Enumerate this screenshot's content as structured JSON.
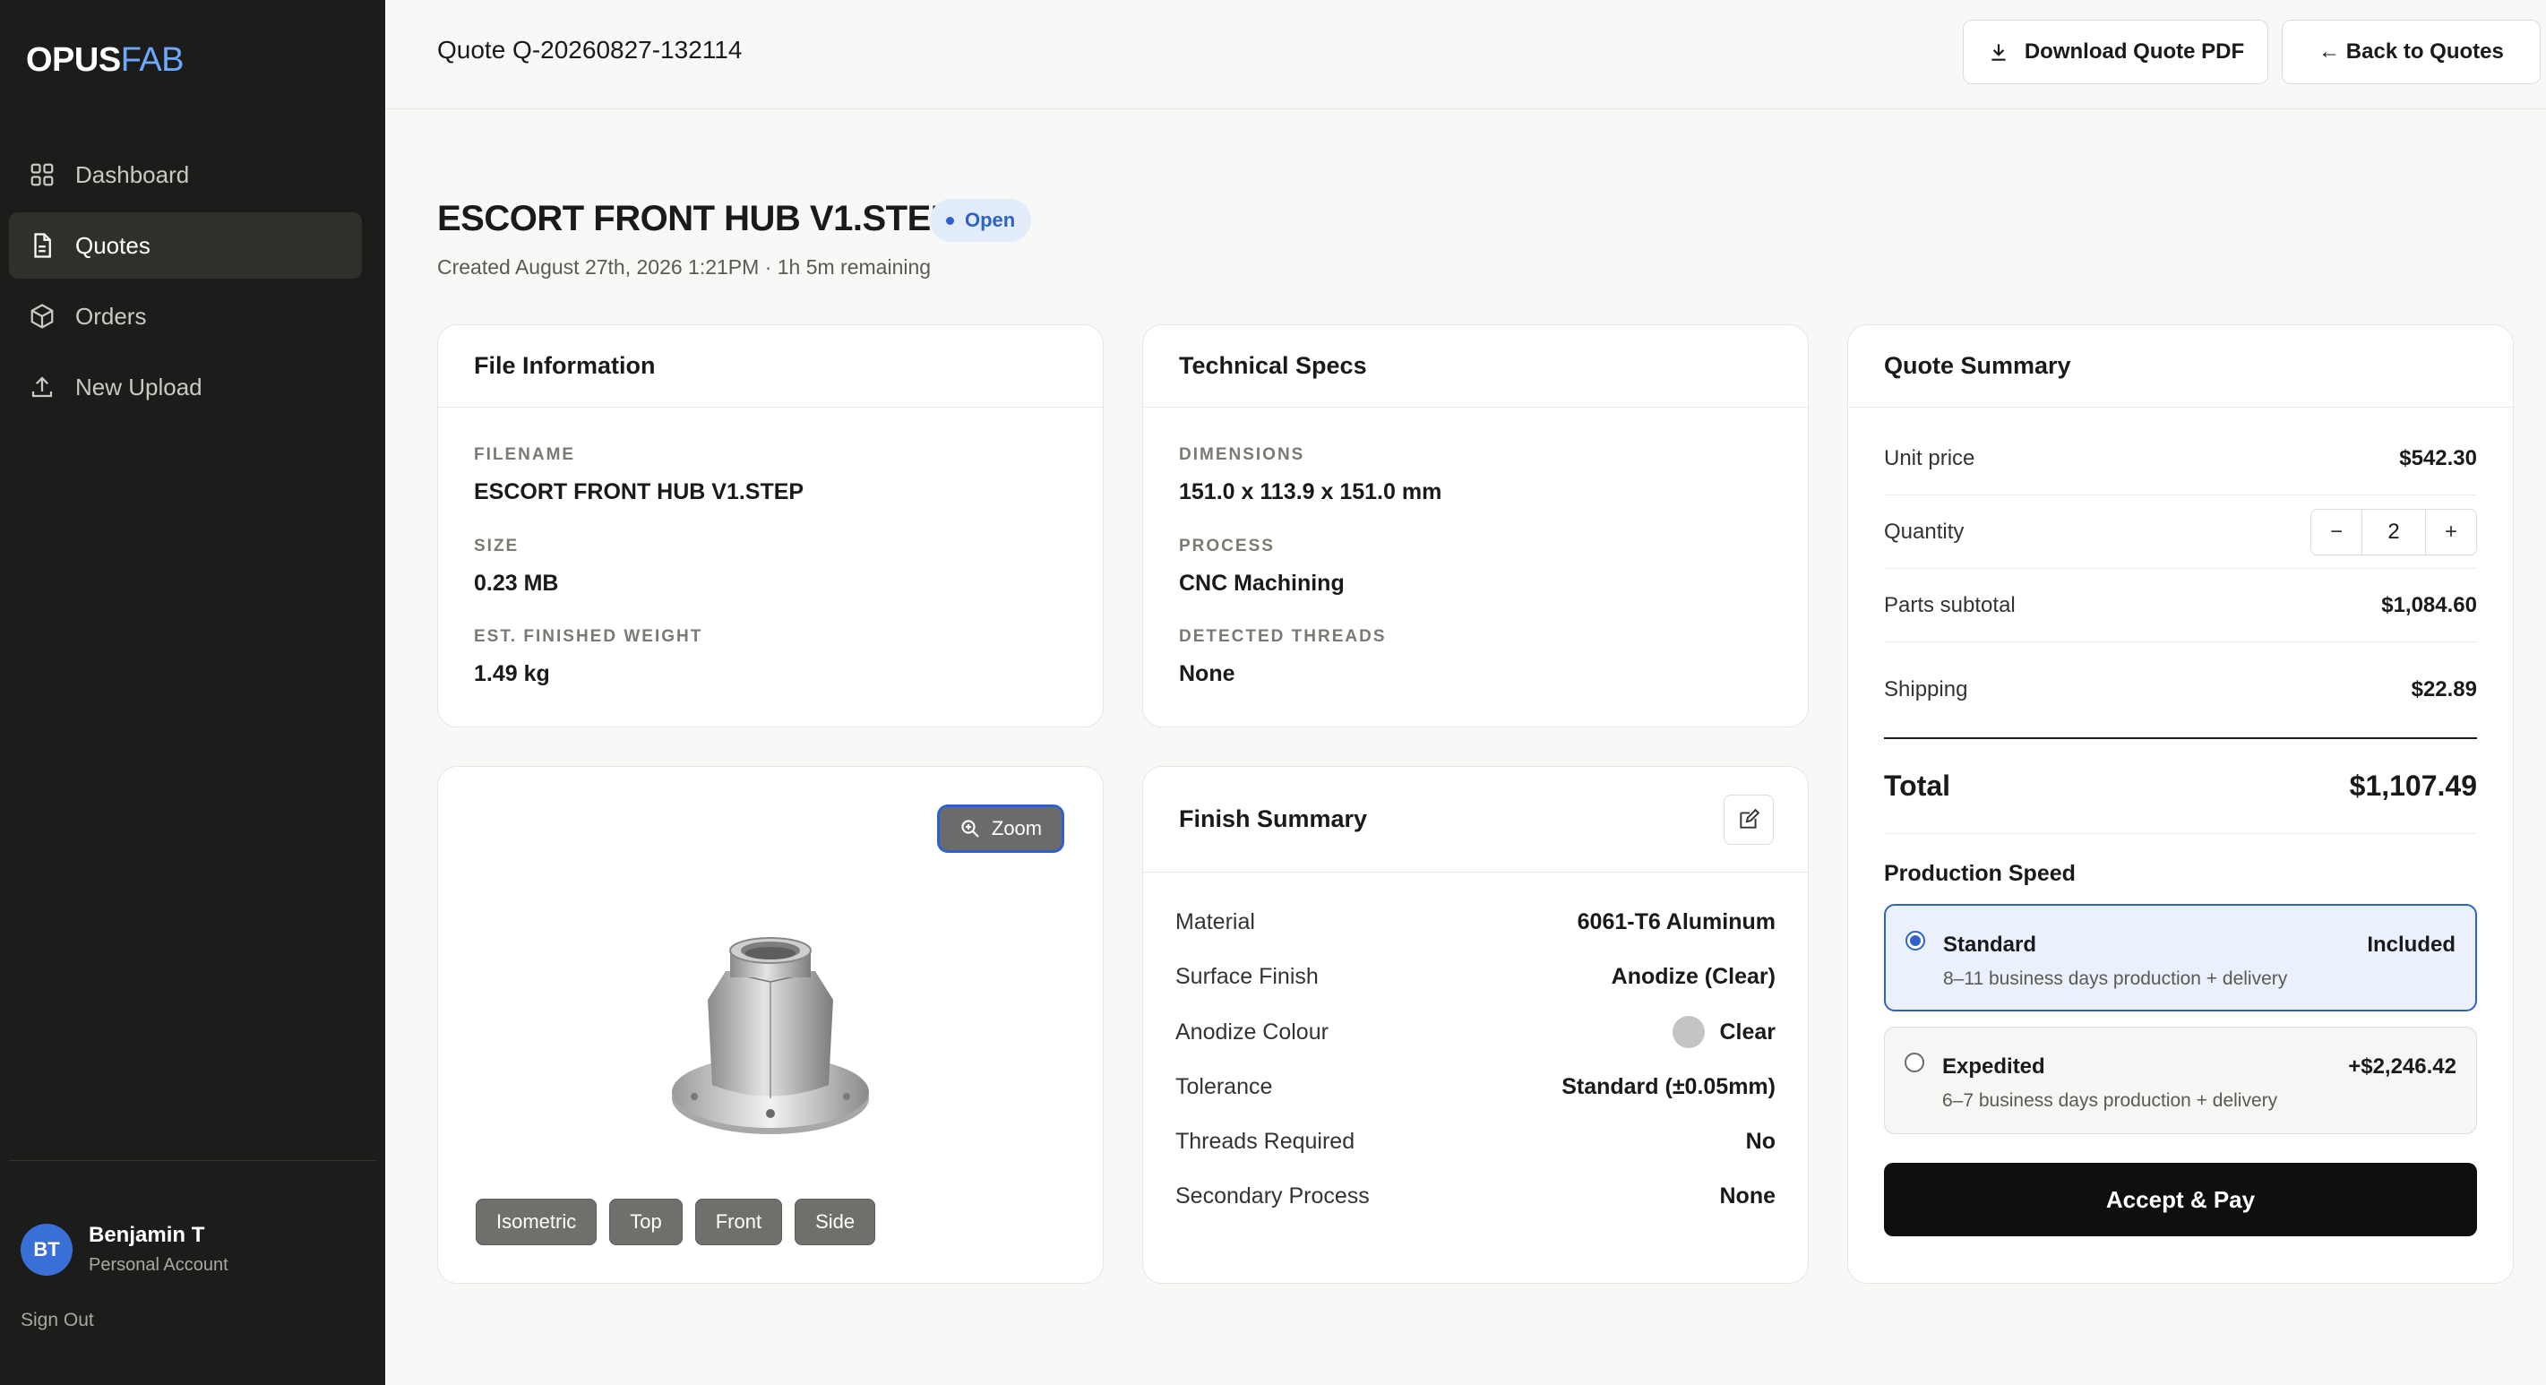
{
  "brand": {
    "part1": "OPUS",
    "part2": "FAB"
  },
  "sidebar": {
    "items": [
      {
        "label": "Dashboard",
        "icon": "grid-icon"
      },
      {
        "label": "Quotes",
        "icon": "document-icon"
      },
      {
        "label": "Orders",
        "icon": "box-icon"
      },
      {
        "label": "New Upload",
        "icon": "upload-icon"
      }
    ],
    "active_index": 1,
    "user": {
      "initials": "BT",
      "name": "Benjamin T",
      "account": "Personal Account"
    },
    "sign_out": "Sign Out"
  },
  "header": {
    "quote_id": "Quote Q-20260827-132114",
    "download_label": "Download Quote PDF",
    "back_label": "← Back to Quotes"
  },
  "title": {
    "name": "ESCORT FRONT HUB V1.STEP",
    "status": "Open",
    "created": "Created August 27th, 2026 1:21PM · 1h 5m remaining"
  },
  "file_info": {
    "heading": "File Information",
    "filename_label": "FILENAME",
    "filename": "ESCORT FRONT HUB V1.STEP",
    "size_label": "SIZE",
    "size": "0.23 MB",
    "weight_label": "EST. FINISHED WEIGHT",
    "weight": "1.49 kg"
  },
  "tech_specs": {
    "heading": "Technical Specs",
    "dimensions_label": "DIMENSIONS",
    "dimensions": "151.0 x 113.9 x 151.0 mm",
    "process_label": "PROCESS",
    "process": "CNC Machining",
    "threads_label": "DETECTED THREADS",
    "threads": "None"
  },
  "viewer": {
    "zoom_label": "Zoom",
    "views": [
      "Isometric",
      "Top",
      "Front",
      "Side"
    ]
  },
  "finish": {
    "heading": "Finish Summary",
    "rows": [
      {
        "k": "Material",
        "v": "6061-T6 Aluminum"
      },
      {
        "k": "Surface Finish",
        "v": "Anodize (Clear)"
      },
      {
        "k": "Anodize Colour",
        "v": "Clear"
      },
      {
        "k": "Tolerance",
        "v": "Standard (±0.05mm)"
      },
      {
        "k": "Threads Required",
        "v": "No"
      },
      {
        "k": "Secondary Process",
        "v": "None"
      }
    ],
    "swatch_color": "#c4c4c4"
  },
  "summary": {
    "heading": "Quote Summary",
    "unit_price_label": "Unit price",
    "unit_price": "$542.30",
    "quantity_label": "Quantity",
    "quantity": "2",
    "minus": "−",
    "plus": "+",
    "subtotal_label": "Parts subtotal",
    "subtotal": "$1,084.60",
    "shipping_label": "Shipping",
    "shipping": "$22.89",
    "total_label": "Total",
    "total": "$1,107.49",
    "speed_title": "Production Speed",
    "options": [
      {
        "name": "Standard",
        "price": "Included",
        "desc": "8–11 business days production + delivery",
        "selected": true
      },
      {
        "name": "Expedited",
        "price": "+$2,246.42",
        "desc": "6–7 business days production + delivery",
        "selected": false
      }
    ],
    "pay_label": "Accept & Pay"
  },
  "colors": {
    "accent": "#2f62c9",
    "sidebar_bg": "#1c1c1a",
    "brand_blue": "#6ea8fe"
  }
}
